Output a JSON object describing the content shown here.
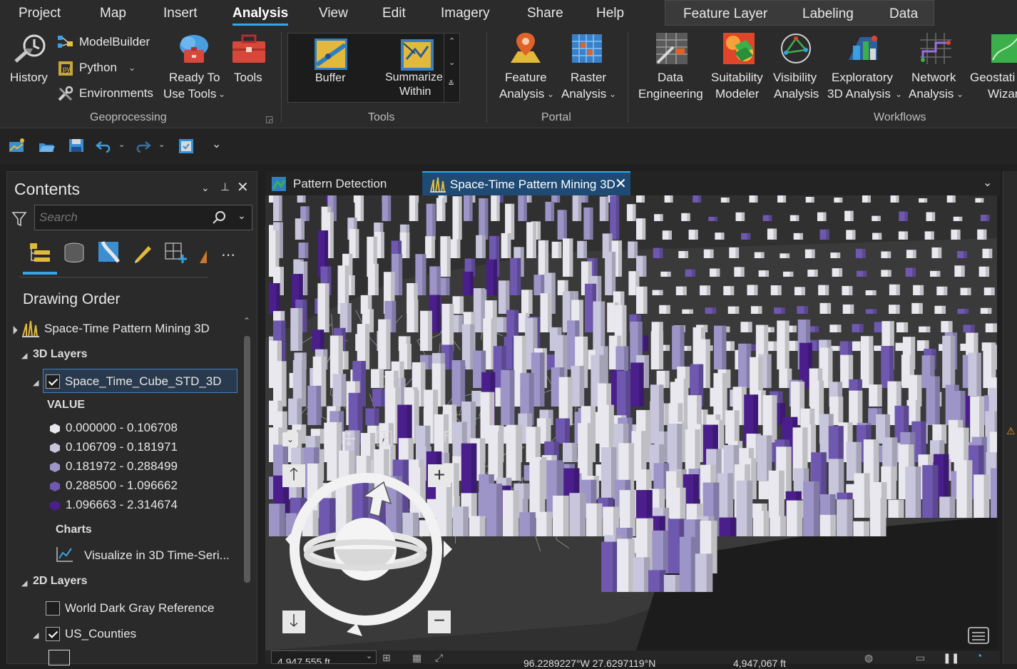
{
  "menu": {
    "items": [
      "Project",
      "Map",
      "Insert",
      "Analysis",
      "View",
      "Edit",
      "Imagery",
      "Share",
      "Help"
    ],
    "active": "Analysis",
    "context_tabs": [
      "Feature Layer",
      "Labeling",
      "Data"
    ]
  },
  "ribbon": {
    "history": "History",
    "modelbuilder": "ModelBuilder",
    "python": "Python",
    "environments": "Environments",
    "ready_to_use_1": "Ready To",
    "ready_to_use_2": "Use Tools",
    "tools": "Tools",
    "geoprocessing_group": "Geoprocessing",
    "buffer": "Buffer",
    "summarize_within_1": "Summarize",
    "summarize_within_2": "Within",
    "tools_group": "Tools",
    "feature_analysis_1": "Feature",
    "feature_analysis_2": "Analysis",
    "raster_analysis_1": "Raster",
    "raster_analysis_2": "Analysis",
    "portal_group": "Portal",
    "data_engineering_1": "Data",
    "data_engineering_2": "Engineering",
    "suitability_1": "Suitability",
    "suitability_2": "Modeler",
    "visibility_1": "Visibility",
    "visibility_2": "Analysis",
    "exploratory_1": "Exploratory",
    "exploratory_2": "3D Analysis",
    "network_1": "Network",
    "network_2": "Analysis",
    "geostat_1": "Geostati",
    "geostat_2": "Wizar",
    "workflows_group": "Workflows"
  },
  "contents": {
    "title": "Contents",
    "search_placeholder": "Search",
    "drawing_order": "Drawing Order",
    "scene_name": "Space-Time Pattern Mining 3D",
    "layers3d": "3D Layers",
    "cube_layer": "Space_Time_Cube_STD_3D",
    "value_label": "VALUE",
    "legend": [
      {
        "label": "0.000000 - 0.106708",
        "color": "#e8e8ee"
      },
      {
        "label": "0.106709 - 0.181971",
        "color": "#c8c6dc"
      },
      {
        "label": "0.181972 - 0.288499",
        "color": "#9d95c8"
      },
      {
        "label": "0.288500 - 1.096662",
        "color": "#6f58b0"
      },
      {
        "label": "1.096663 - 2.314674",
        "color": "#4a1f8c"
      }
    ],
    "charts": "Charts",
    "chart_item": "Visualize in 3D Time-Seri...",
    "layers2d": "2D Layers",
    "world_dark": "World Dark Gray Reference",
    "us_counties": "US_Counties"
  },
  "tabs": {
    "tab1": "Pattern Detection",
    "tab2": "Space-Time Pattern Mining 3D"
  },
  "status": {
    "scale": "4,947,555 ft",
    "coords": "96.2289227°W 27.6297119°N",
    "elevation": "4,947,067 ft"
  },
  "colors": {
    "accent": "#35a6e8",
    "bg": "#1f1f1f"
  }
}
